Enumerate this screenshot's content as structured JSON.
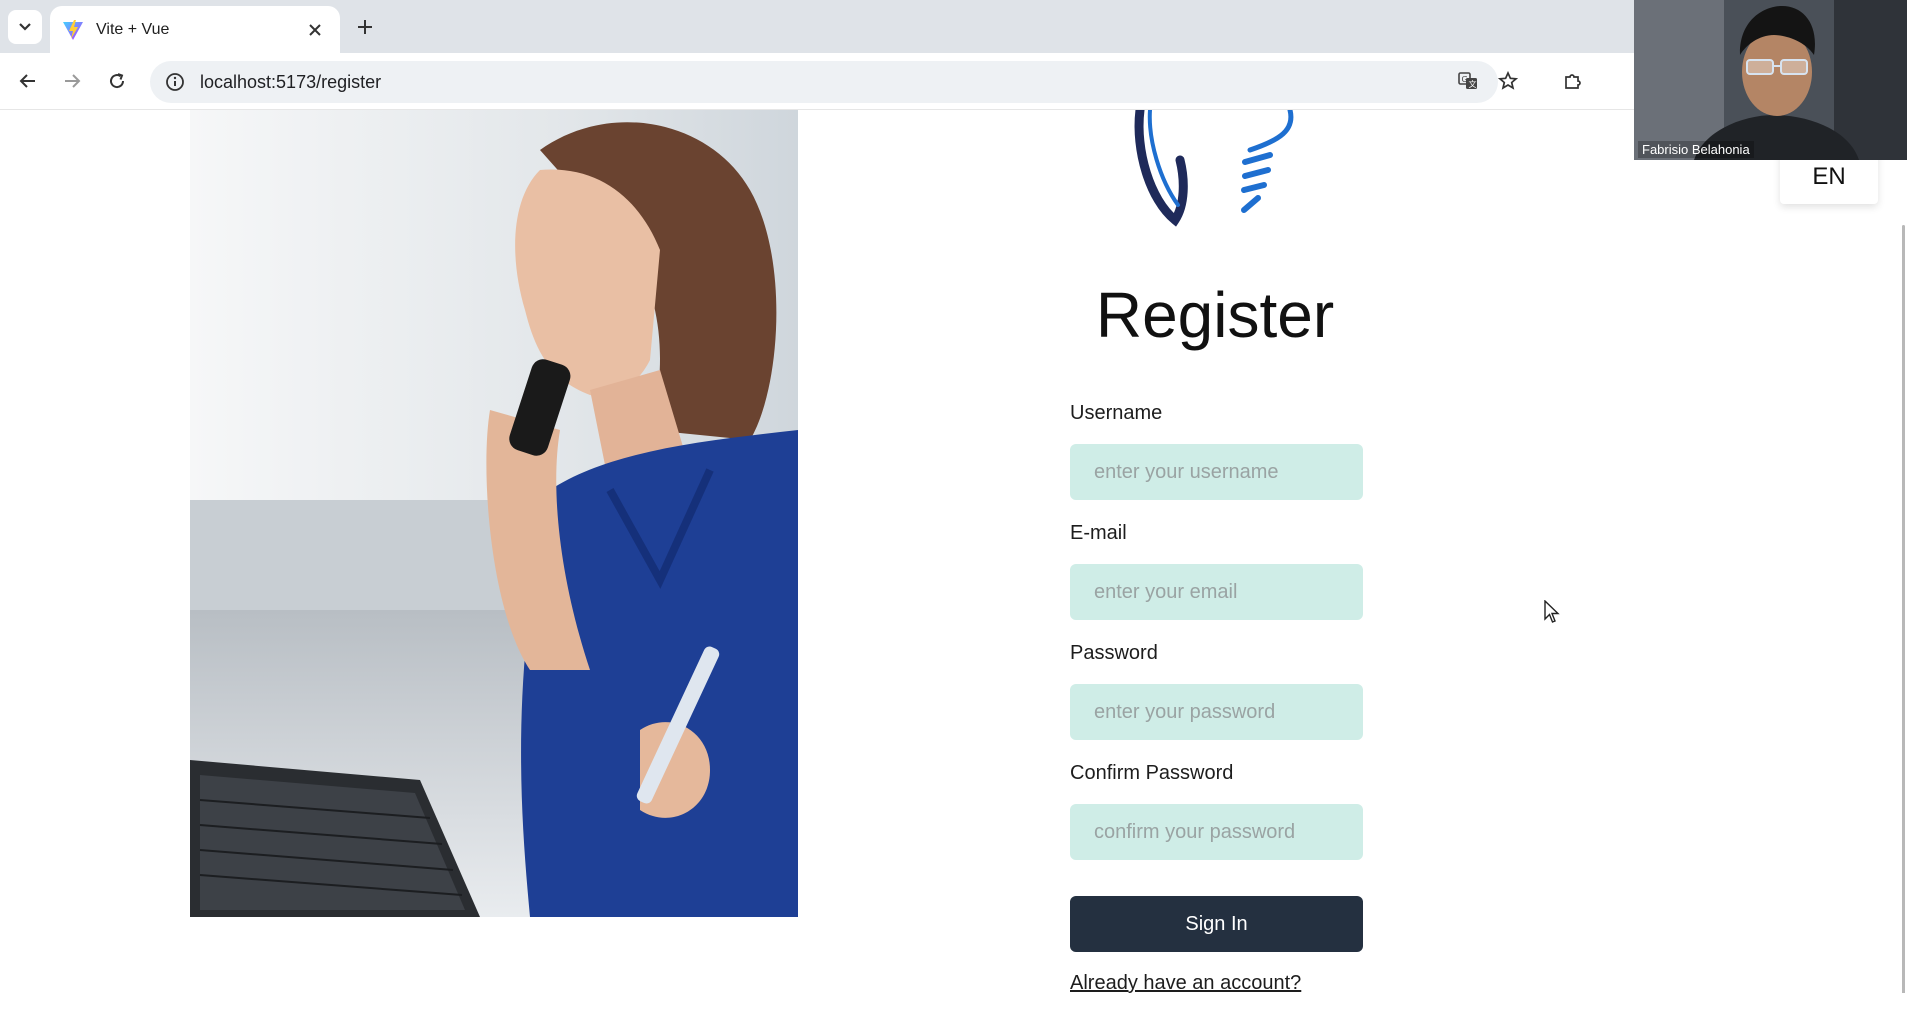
{
  "browser": {
    "tab_title": "Vite + Vue",
    "url": "localhost:5173/register"
  },
  "page": {
    "title": "Register",
    "language": "EN",
    "fields": [
      {
        "label": "Username",
        "placeholder": "enter your username"
      },
      {
        "label": "E-mail",
        "placeholder": "enter your email"
      },
      {
        "label": "Password",
        "placeholder": "enter your password"
      },
      {
        "label": "Confirm Password",
        "placeholder": "confirm your password"
      }
    ],
    "submit_label": "Sign In",
    "login_link": "Already have an account?"
  },
  "webcam": {
    "participant_name": "Fabrisio Belahonia"
  },
  "colors": {
    "input_bg": "#cfede7",
    "button_bg": "#243040",
    "logo_dark": "#1f2a5a",
    "logo_blue": "#1e6fd0"
  }
}
